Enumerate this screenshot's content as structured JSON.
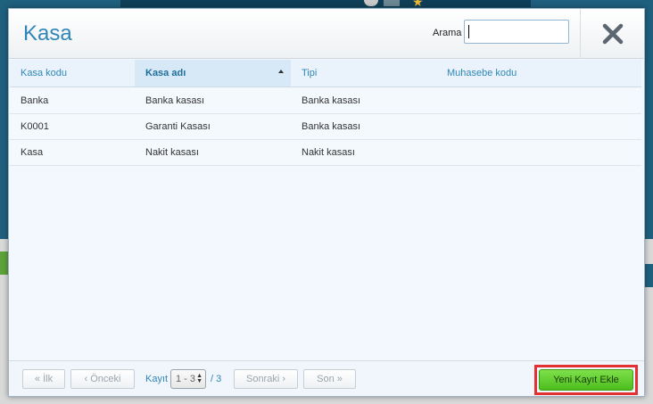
{
  "modal": {
    "title": "Kasa",
    "search": {
      "label": "Arama",
      "value": "",
      "placeholder": ""
    },
    "close_icon": "close-x-icon"
  },
  "table": {
    "columns": [
      "Kasa kodu",
      "Kasa adı",
      "Tipi",
      "Muhasebe kodu"
    ],
    "sorted_column": "Kasa adı",
    "rows": [
      [
        "Banka",
        "Banka kasası",
        "Banka kasası",
        ""
      ],
      [
        "K0001",
        "Garanti Kasası",
        "Banka kasası",
        ""
      ],
      [
        "Kasa",
        "Nakit kasası",
        "Nakit kasası",
        ""
      ]
    ]
  },
  "pagination": {
    "first": "« İlk",
    "prev": "‹ Önceki",
    "record_label": "Kayıt",
    "current": "1 - 3",
    "total": "/ 3",
    "next": "Sonraki ›",
    "last": "Son »"
  },
  "actions": {
    "new_record": "Yeni Kayıt Ekle"
  },
  "colors": {
    "accent": "#2f86b7",
    "primary_button": "#5cc92a",
    "highlight": "#e33131"
  }
}
